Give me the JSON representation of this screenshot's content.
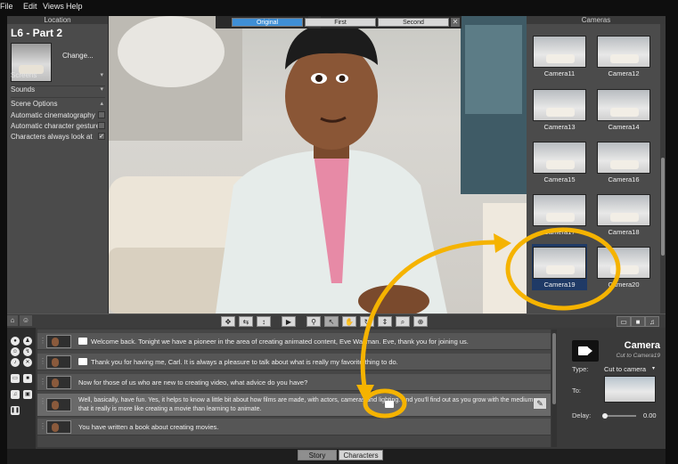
{
  "menu": [
    "File",
    "Edit",
    "Views",
    "Help"
  ],
  "location": {
    "header": "Location",
    "title": "L6 - Part 2",
    "change_label": "Change...",
    "sections": [
      "Screens",
      "Sounds"
    ],
    "scene_options_label": "Scene Options",
    "options": [
      {
        "label": "Automatic cinematography",
        "checked": false
      },
      {
        "label": "Automatic character gestures",
        "checked": false
      },
      {
        "label": "Characters always look at",
        "checked": true
      }
    ]
  },
  "viewport": {
    "tabs": [
      {
        "label": "Original",
        "active": true
      },
      {
        "label": "First",
        "active": false
      },
      {
        "label": "Second",
        "active": false
      }
    ],
    "close_label": "✕"
  },
  "cameras": {
    "header": "Cameras",
    "items": [
      {
        "label": "Camera11"
      },
      {
        "label": "Camera12"
      },
      {
        "label": "Camera13"
      },
      {
        "label": "Camera14"
      },
      {
        "label": "Camera15"
      },
      {
        "label": "Camera16"
      },
      {
        "label": "Camera17"
      },
      {
        "label": "Camera18"
      },
      {
        "label": "Camera19",
        "selected": true
      },
      {
        "label": "Camera20"
      }
    ]
  },
  "script": {
    "lines": [
      {
        "text": "Welcome back. Tonight we have a pioneer in the area of creating animated content, Eve Waltman. Eve, thank you for joining us.",
        "camera": true
      },
      {
        "text": "Thank you for having me, Carl. It is always a pleasure to talk about what is really my favorite thing to do.",
        "camera": true
      },
      {
        "text": "Now for those of us who are new to creating video, what advice do you have?",
        "camera": false
      },
      {
        "text": "Well, basically, have fun. Yes, it helps to know a little bit about how films are made, with actors, cameras and lighting. And you'll find out as you grow with the medium that it really is more like creating a movie than learning to animate.",
        "camera": true,
        "highlight": true
      },
      {
        "text": "You have written a book about creating movies.",
        "camera": false
      }
    ]
  },
  "properties": {
    "title": "Camera",
    "subtitle": "Cut to Camera19",
    "type_label": "Type:",
    "type_value": "Cut to camera",
    "to_label": "To:",
    "delay_label": "Delay:",
    "delay_value": "0.00"
  },
  "bottom_tabs": [
    {
      "label": "Story",
      "active": true
    },
    {
      "label": "Characters",
      "active": false
    }
  ],
  "colors": {
    "highlight": "#f5b300",
    "selected_camera_bg": "#1f3a66",
    "active_tab": "#3f8fd6"
  }
}
